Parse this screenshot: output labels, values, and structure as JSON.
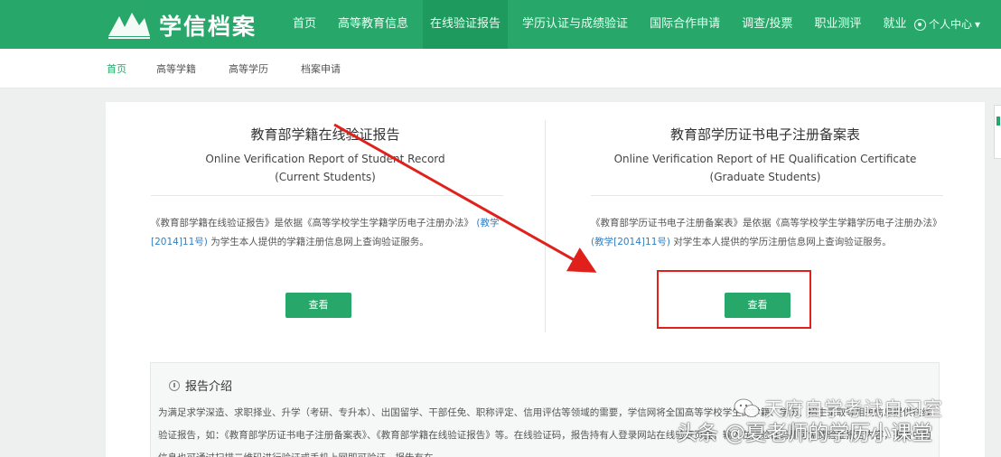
{
  "header": {
    "logo_text": "学信档案",
    "nav": [
      {
        "label": "首页"
      },
      {
        "label": "高等教育信息"
      },
      {
        "label": "在线验证报告",
        "active": true
      },
      {
        "label": "学历认证与成绩验证"
      },
      {
        "label": "国际合作申请"
      },
      {
        "label": "调查/投票"
      },
      {
        "label": "职业测评"
      },
      {
        "label": "就业"
      }
    ],
    "user_label": "个人中心"
  },
  "subnav": [
    "首页",
    "高等学籍",
    "高等学历",
    "档案申请"
  ],
  "cards": [
    {
      "title": "教育部学籍在线验证报告",
      "subtitle_en": "Online Verification Report of Student Record",
      "subtitle_note": "(Current Students)",
      "desc_pre": "《教育部学籍在线验证报告》是依据《高等学校学生学籍学历电子注册办法》",
      "desc_link": "(教学[2014]11号)",
      "desc_post": "为学生本人提供的学籍注册信息网上查询验证服务。",
      "button": "查看"
    },
    {
      "title": "教育部学历证书电子注册备案表",
      "subtitle_en": "Online Verification Report of HE Qualification Certificate",
      "subtitle_note": "(Graduate Students)",
      "desc_pre": "《教育部学历证书电子注册备案表》是依据《高等学校学生学籍学历电子注册办法》",
      "desc_link": "(教学[2014]11号)",
      "desc_post": "对学生本人提供的学历注册信息网上查询验证服务。",
      "button": "查看"
    }
  ],
  "intro": {
    "title": "报告介绍",
    "text": "为满足求学深造、求职择业、升学（考研、专升本）、出国留学、干部任免、职称评定、信用评估等领域的需要，学信网将全国高等学校学生的学籍、学历、招生录取等相关信息提供在线验证报告，如：《教育部学历证书电子注册备案表》、《教育部学籍在线验证报告》等。在线验证码，报告持有人登录网站在线验证页面，输入在线验证码即可免费验证报告内容，报告中的信息也可通过扫描二维码进行验证或手机上网即可验证，报告有在"
  },
  "watermark": {
    "line1": "天府自学考试自习室",
    "line2": "头条 @夏老师的学历小课堂"
  },
  "colors": {
    "brand": "#27a86a",
    "annotation": "#e0201b",
    "link": "#2f7fc4"
  }
}
